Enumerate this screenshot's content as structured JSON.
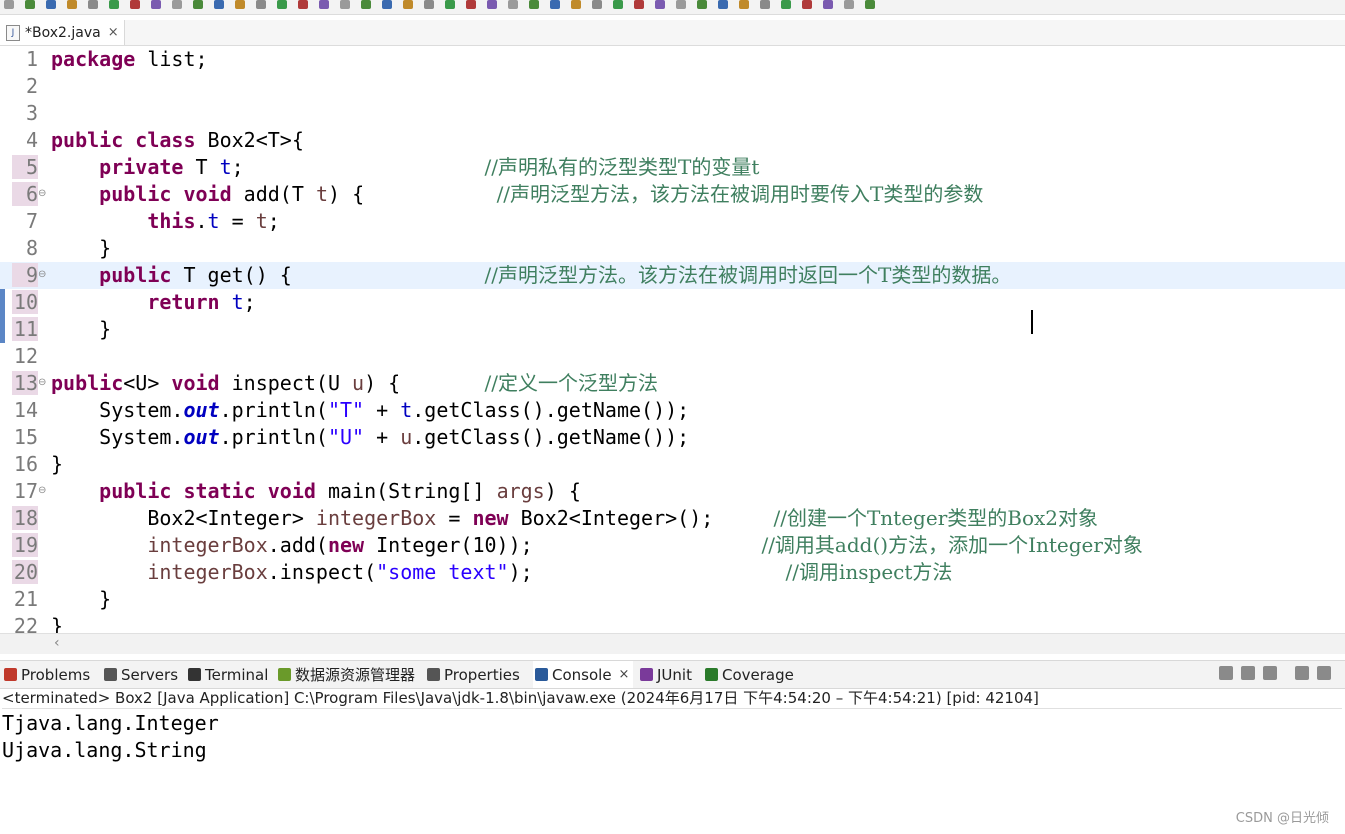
{
  "colors": {
    "keyword": "#7f0055",
    "field": "#0000c0",
    "comment": "#3f7f5f",
    "string": "#2a00ff",
    "current_line": "#e8f2fe"
  },
  "editor_tab": {
    "icon": "java-file-icon",
    "label": "*Box2.java",
    "close": "×"
  },
  "code_lines": [
    {
      "num": "1",
      "tokens": [
        [
          "kw",
          "package"
        ],
        [
          "t",
          " list;"
        ]
      ]
    },
    {
      "num": "2",
      "tokens": []
    },
    {
      "num": "3",
      "tokens": []
    },
    {
      "num": "4",
      "tokens": [
        [
          "kw",
          "public"
        ],
        [
          "t",
          " "
        ],
        [
          "kw",
          "class"
        ],
        [
          "t",
          " Box2<T>{"
        ]
      ]
    },
    {
      "num": "5",
      "tokens": [
        [
          "t",
          "    "
        ],
        [
          "kw",
          "private"
        ],
        [
          "t",
          " T "
        ],
        [
          "fld",
          "t"
        ],
        [
          "t",
          ";                    "
        ],
        [
          "cm",
          "//声明私有的泛型类型T的变量t"
        ]
      ]
    },
    {
      "num": "6",
      "tokens": [
        [
          "t",
          "    "
        ],
        [
          "kw",
          "public"
        ],
        [
          "t",
          " "
        ],
        [
          "kw",
          "void"
        ],
        [
          "t",
          " add(T "
        ],
        [
          "var",
          "t"
        ],
        [
          "t",
          ") {           "
        ],
        [
          "cm",
          "//声明泛型方法，该方法在被调用时要传入T类型的参数"
        ]
      ]
    },
    {
      "num": "7",
      "tokens": [
        [
          "t",
          "        "
        ],
        [
          "kw",
          "this"
        ],
        [
          "t",
          "."
        ],
        [
          "fld",
          "t"
        ],
        [
          "t",
          " = "
        ],
        [
          "var",
          "t"
        ],
        [
          "t",
          ";"
        ]
      ]
    },
    {
      "num": "8",
      "tokens": [
        [
          "t",
          "    }"
        ]
      ]
    },
    {
      "num": "9",
      "tokens": [
        [
          "t",
          "    "
        ],
        [
          "kw",
          "public"
        ],
        [
          "t",
          " T get() {                "
        ],
        [
          "cm",
          "//声明泛型方法。该方法在被调用时返回一个T类型的数据。"
        ]
      ]
    },
    {
      "num": "10",
      "tokens": [
        [
          "t",
          "        "
        ],
        [
          "kw",
          "return"
        ],
        [
          "t",
          " "
        ],
        [
          "fld",
          "t"
        ],
        [
          "t",
          ";"
        ]
      ]
    },
    {
      "num": "11",
      "tokens": [
        [
          "t",
          "    }"
        ]
      ]
    },
    {
      "num": "12",
      "tokens": []
    },
    {
      "num": "13",
      "tokens": [
        [
          "kw",
          "public"
        ],
        [
          "t",
          "<U> "
        ],
        [
          "kw",
          "void"
        ],
        [
          "t",
          " inspect(U "
        ],
        [
          "var",
          "u"
        ],
        [
          "t",
          ") {       "
        ],
        [
          "cm",
          "//定义一个泛型方法"
        ]
      ]
    },
    {
      "num": "14",
      "tokens": [
        [
          "t",
          "    System."
        ],
        [
          "sfld",
          "out"
        ],
        [
          "t",
          ".println("
        ],
        [
          "str",
          "\"T\""
        ],
        [
          "t",
          " + "
        ],
        [
          "fld",
          "t"
        ],
        [
          "t",
          ".getClass().getName());"
        ]
      ]
    },
    {
      "num": "15",
      "tokens": [
        [
          "t",
          "    System."
        ],
        [
          "sfld",
          "out"
        ],
        [
          "t",
          ".println("
        ],
        [
          "str",
          "\"U\""
        ],
        [
          "t",
          " + "
        ],
        [
          "var",
          "u"
        ],
        [
          "t",
          ".getClass().getName());"
        ]
      ]
    },
    {
      "num": "16",
      "tokens": [
        [
          "t",
          "}"
        ]
      ]
    },
    {
      "num": "17",
      "tokens": [
        [
          "t",
          "    "
        ],
        [
          "kw",
          "public"
        ],
        [
          "t",
          " "
        ],
        [
          "kw",
          "static"
        ],
        [
          "t",
          " "
        ],
        [
          "kw",
          "void"
        ],
        [
          "t",
          " main(String[] "
        ],
        [
          "var",
          "args"
        ],
        [
          "t",
          ") {"
        ]
      ]
    },
    {
      "num": "18",
      "tokens": [
        [
          "t",
          "        Box2<Integer> "
        ],
        [
          "var",
          "integerBox"
        ],
        [
          "t",
          " = "
        ],
        [
          "kw",
          "new"
        ],
        [
          "t",
          " Box2<Integer>();     "
        ],
        [
          "cm",
          "//创建一个Tnteger类型的Box2对象"
        ]
      ]
    },
    {
      "num": "19",
      "tokens": [
        [
          "t",
          "        "
        ],
        [
          "var",
          "integerBox"
        ],
        [
          "t",
          ".add("
        ],
        [
          "kw",
          "new"
        ],
        [
          "t",
          " Integer(10));                   "
        ],
        [
          "cm",
          "//调用其add()方法，添加一个Integer对象"
        ]
      ]
    },
    {
      "num": "20",
      "tokens": [
        [
          "t",
          "        "
        ],
        [
          "var",
          "integerBox"
        ],
        [
          "t",
          ".inspect("
        ],
        [
          "str",
          "\"some text\""
        ],
        [
          "t",
          ");                     "
        ],
        [
          "cm",
          "//调用inspect方法"
        ]
      ]
    },
    {
      "num": "21",
      "tokens": [
        [
          "t",
          "    }"
        ]
      ]
    },
    {
      "num": "22",
      "tokens": [
        [
          "t",
          "}"
        ]
      ]
    }
  ],
  "panel_tabs": [
    {
      "label": "Problems",
      "icon": "problems-icon",
      "color": "#c0392b"
    },
    {
      "label": "Servers",
      "icon": "servers-icon",
      "color": "#555555"
    },
    {
      "label": "Terminal",
      "icon": "terminal-icon",
      "color": "#333333"
    },
    {
      "label": "数据源资源管理器",
      "icon": "datasource-explorer-icon",
      "color": "#6a9a2a"
    },
    {
      "label": "Properties",
      "icon": "properties-icon",
      "color": "#555555"
    },
    {
      "label": "Console",
      "icon": "console-icon",
      "color": "#2a5a9a",
      "active": true,
      "close": "×"
    },
    {
      "label": "JUnit",
      "icon": "junit-icon",
      "color": "#7a3a9a"
    },
    {
      "label": "Coverage",
      "icon": "coverage-icon",
      "color": "#2a7a2a"
    }
  ],
  "console": {
    "status": "<terminated> Box2 [Java Application] C:\\Program Files\\Java\\jdk-1.8\\bin\\javaw.exe  (2024年6月17日 下午4:54:20 – 下午4:54:21) [pid: 42104]",
    "output": [
      "Tjava.lang.Integer",
      "Ujava.lang.String"
    ]
  },
  "watermark": "CSDN @日光倾"
}
